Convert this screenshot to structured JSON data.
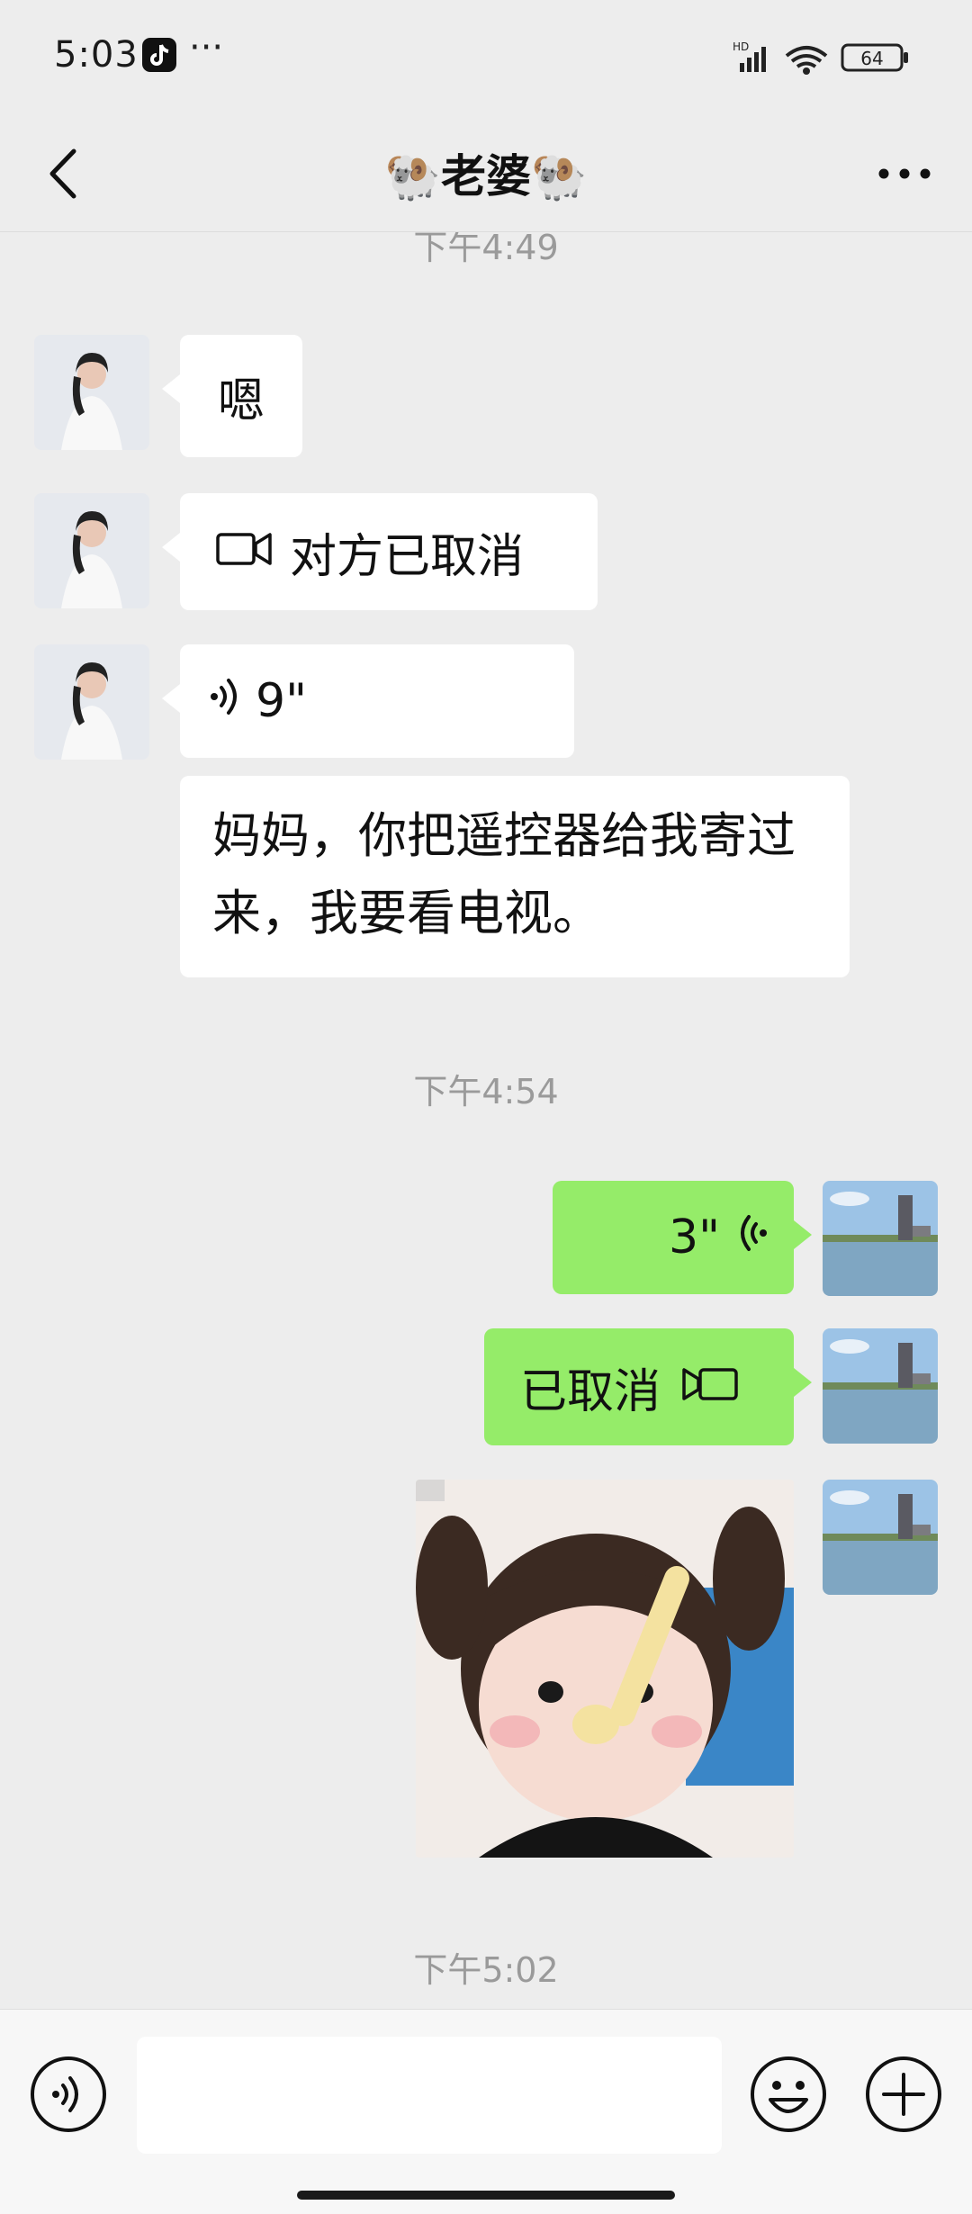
{
  "status_bar": {
    "time": "5:03",
    "dots": "···",
    "battery": "64",
    "network_badge": "HD"
  },
  "header": {
    "title": "🐏老婆🐏",
    "back_icon": "chevron-left-icon",
    "more_icon": "more-dots-icon"
  },
  "messages": {
    "timestamp_1": "下午4:49",
    "msg_1": "嗯",
    "msg_2": "对方已取消",
    "msg_3_duration": "9\"",
    "msg_4": "妈妈，你把遥控器给我寄过来，我要看电视。",
    "timestamp_2": "下午4:54",
    "msg_5_duration": "3\"",
    "msg_6": "已取消",
    "timestamp_3": "下午5:02"
  },
  "input_bar": {
    "placeholder": "",
    "voice_icon": "voice-toggle-icon",
    "emoji_icon": "emoji-icon",
    "plus_icon": "plus-icon"
  },
  "colors": {
    "background": "#ededed",
    "incoming_bubble": "#ffffff",
    "outgoing_bubble": "#95ec69",
    "timestamp": "#9a9a9a"
  }
}
